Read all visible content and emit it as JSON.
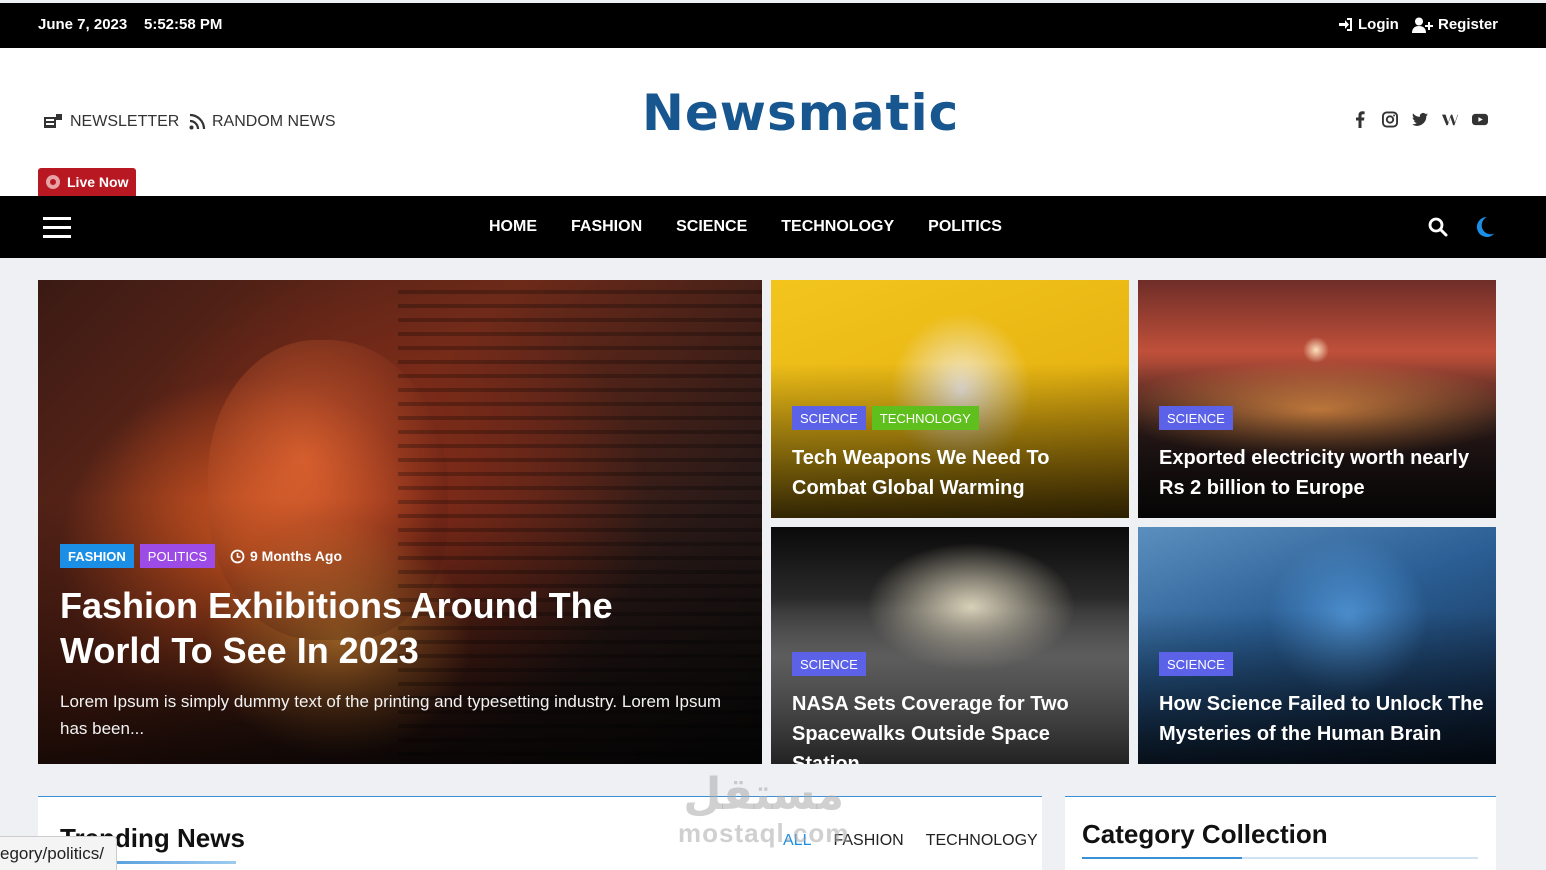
{
  "topbar": {
    "date": "June 7, 2023",
    "time": "5:52:58 PM",
    "login": "Login",
    "register": "Register"
  },
  "header": {
    "newsletter": "NEWSLETTER",
    "random_news": "RANDOM NEWS",
    "logo": "Newsmatic",
    "live_now": "Live Now",
    "socials": [
      "facebook-icon",
      "instagram-icon",
      "twitter-icon",
      "wikipedia-icon",
      "youtube-icon"
    ]
  },
  "nav": {
    "items": [
      "HOME",
      "FASHION",
      "SCIENCE",
      "TECHNOLOGY",
      "POLITICS"
    ]
  },
  "featured": {
    "main": {
      "tags": [
        "FASHION",
        "POLITICS"
      ],
      "time": "9 Months Ago",
      "title": "Fashion Exhibitions Around The World To See In 2023",
      "excerpt": "Lorem Ipsum is simply dummy text of the printing and typesetting industry. Lorem Ipsum has been..."
    },
    "cards": [
      {
        "tags": [
          "SCIENCE",
          "TECHNOLOGY"
        ],
        "title": "Tech Weapons We Need To Combat Global Warming"
      },
      {
        "tags": [
          "SCIENCE"
        ],
        "title": "Exported electricity worth nearly Rs 2 billion to Europe"
      },
      {
        "tags": [
          "SCIENCE"
        ],
        "title": "NASA Sets Coverage for Two Spacewalks Outside Space Station"
      },
      {
        "tags": [
          "SCIENCE"
        ],
        "title": "How Science Failed to Unlock The Mysteries of the Human Brain"
      }
    ]
  },
  "trending": {
    "title": "Trending News",
    "filters": [
      "ALL",
      "FASHION",
      "TECHNOLOGY"
    ],
    "active_filter": "ALL"
  },
  "category_collection": {
    "title": "Category Collection"
  },
  "status_url": "egory/politics/",
  "watermark": {
    "arabic": "مستقل",
    "latin": "mostaql.com"
  },
  "colors": {
    "accent": "#1b8fe6",
    "logo": "#17568e",
    "live": "#b81822",
    "science_tag": "#5b62e8",
    "technology_tag": "#5fbf1c",
    "politics_tag": "#9c4be6"
  }
}
